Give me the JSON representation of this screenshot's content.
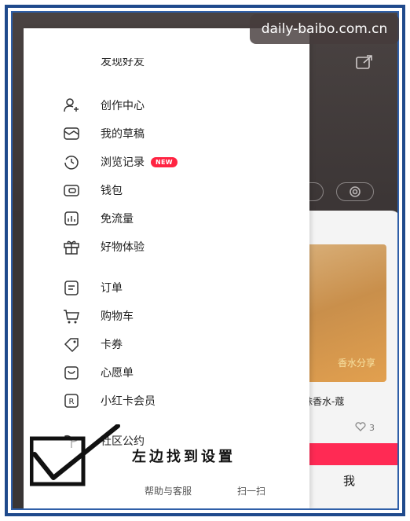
{
  "watermark": {
    "text": "daily-baibo.com.cn"
  },
  "drawer": {
    "top_cut_label": "发现好友",
    "items": [
      {
        "label": "创作中心",
        "icon": "creator-center-icon"
      },
      {
        "label": "我的草稿",
        "icon": "drafts-icon"
      },
      {
        "label": "浏览记录",
        "icon": "history-clock-icon",
        "badge": "NEW"
      },
      {
        "label": "钱包",
        "icon": "wallet-icon"
      },
      {
        "label": "免流量",
        "icon": "data-free-icon"
      },
      {
        "label": "好物体验",
        "icon": "gift-icon"
      },
      {
        "label": "订单",
        "icon": "order-icon"
      },
      {
        "label": "购物车",
        "icon": "cart-icon"
      },
      {
        "label": "卡券",
        "icon": "coupon-icon"
      },
      {
        "label": "心愿单",
        "icon": "wishlist-icon"
      },
      {
        "label": "小红卡会员",
        "icon": "membership-card-icon"
      },
      {
        "label": "社区公约",
        "icon": "sprout-icon"
      }
    ],
    "bottom": {
      "help": "帮助与客服",
      "scan": "扫一扫"
    }
  },
  "background_page": {
    "pill_count": "4",
    "card_caption": "甜妹香水-蔻",
    "card_photo_label": "香水分享",
    "likes": "3",
    "tab_me": "我"
  },
  "annotation": {
    "text": "左边找到设置"
  },
  "colors": {
    "frame": "#1f4a8c",
    "badge": "#ff2442",
    "accent": "#ff2a54"
  }
}
